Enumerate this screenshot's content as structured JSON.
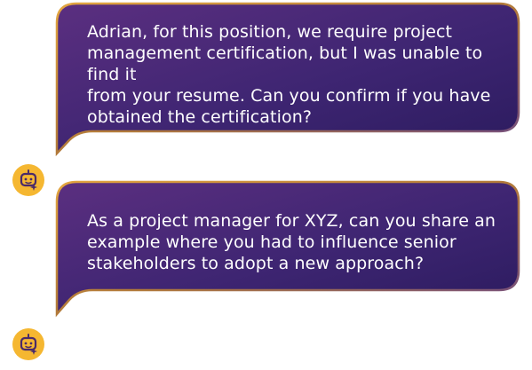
{
  "messages": [
    {
      "sender_icon": "bot-face-icon",
      "text": "Adrian, for this position, we require project\nmanagement certification, but I was unable to find it\nfrom your resume. Can you confirm if you have\nobtained the certification?"
    },
    {
      "sender_icon": "bot-face-icon",
      "text": "As a project manager for XYZ, can you share an\nexample where you had to influence senior\nstakeholders to adopt a new approach?"
    }
  ],
  "colors": {
    "bubble_gradient_start": "#5a2f7e",
    "bubble_gradient_mid": "#3d2470",
    "bubble_gradient_end": "#2a1a5c",
    "bubble_border": "#d89a3c",
    "avatar_background": "#f5b731",
    "avatar_icon": "#4a2a6a",
    "text": "#ffffff"
  }
}
